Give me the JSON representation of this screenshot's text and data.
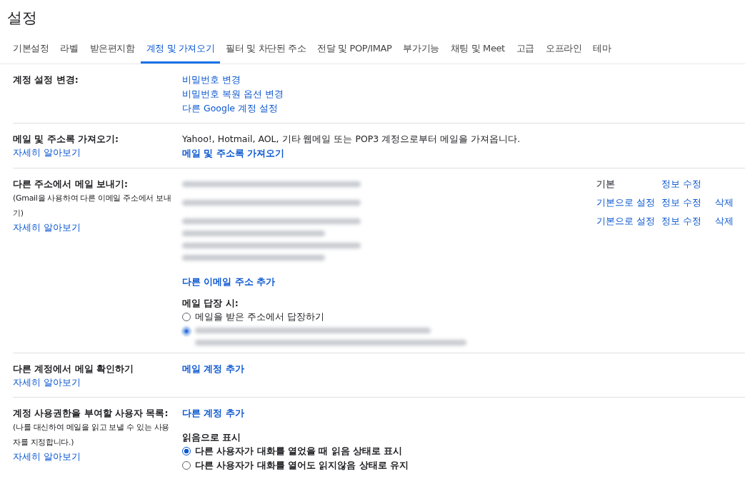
{
  "title": "설정",
  "tabs": [
    {
      "label": "기본설정",
      "selected": false
    },
    {
      "label": "라벨",
      "selected": false
    },
    {
      "label": "받은편지함",
      "selected": false
    },
    {
      "label": "계정 및 가져오기",
      "selected": true
    },
    {
      "label": "필터 및 차단된 주소",
      "selected": false
    },
    {
      "label": "전달 및 POP/IMAP",
      "selected": false
    },
    {
      "label": "부가기능",
      "selected": false
    },
    {
      "label": "채팅 및 Meet",
      "selected": false
    },
    {
      "label": "고급",
      "selected": false
    },
    {
      "label": "오프라인",
      "selected": false
    },
    {
      "label": "테마",
      "selected": false
    }
  ],
  "account_settings": {
    "label": "계정 설정 변경:",
    "links": [
      "비밀번호 변경",
      "비밀번호 복원 옵션 변경",
      "다른 Google 계정 설정"
    ]
  },
  "import": {
    "label": "메일 및 주소록 가져오기:",
    "learn_more": "자세히 알아보기",
    "description": "Yahoo!, Hotmail, AOL, 기타 웹메일 또는 POP3 계정으로부터 메일을 가져옵니다.",
    "action": "메일 및 주소록 가져오기"
  },
  "send_as": {
    "label": "다른 주소에서 메일 보내기:",
    "note": "(Gmail을 사용하여 다른 이메일 주소에서 보내기)",
    "learn_more": "자세히 알아보기",
    "accounts": [
      {
        "default": true,
        "default_label": "기본",
        "edit": "정보 수정"
      },
      {
        "default": false,
        "default_label": "기본으로 설정",
        "edit": "정보 수정",
        "delete": "삭제"
      },
      {
        "default": false,
        "default_label": "기본으로 설정",
        "edit": "정보 수정",
        "delete": "삭제"
      }
    ],
    "add": "다른 이메일 주소 추가",
    "reply_heading": "메일 답장 시:",
    "reply_options": [
      {
        "kind": "text",
        "label": "메일을 받은 주소에서 답장하기",
        "selected": false
      },
      {
        "kind": "blurred",
        "selected": true
      }
    ]
  },
  "check_mail": {
    "label": "다른 계정에서 메일 확인하기",
    "learn_more": "자세히 알아보기",
    "action": "메일 계정 추가"
  },
  "delegation": {
    "label": "계정 사용권한을 부여할 사용자 목록:",
    "note": "(나를 대신하여 메일을 읽고 보낼 수 있는 사용자를 지정합니다.)",
    "learn_more": "자세히 알아보기",
    "action": "다른 계정 추가",
    "mark_heading": "읽음으로 표시",
    "options": [
      {
        "label": "다른 사용자가 대화를 열었을 때 읽음 상태로 표시",
        "selected": true
      },
      {
        "label": "다른 사용자가 대화를 열어도 읽지않음 상태로 유지",
        "selected": false
      }
    ]
  }
}
